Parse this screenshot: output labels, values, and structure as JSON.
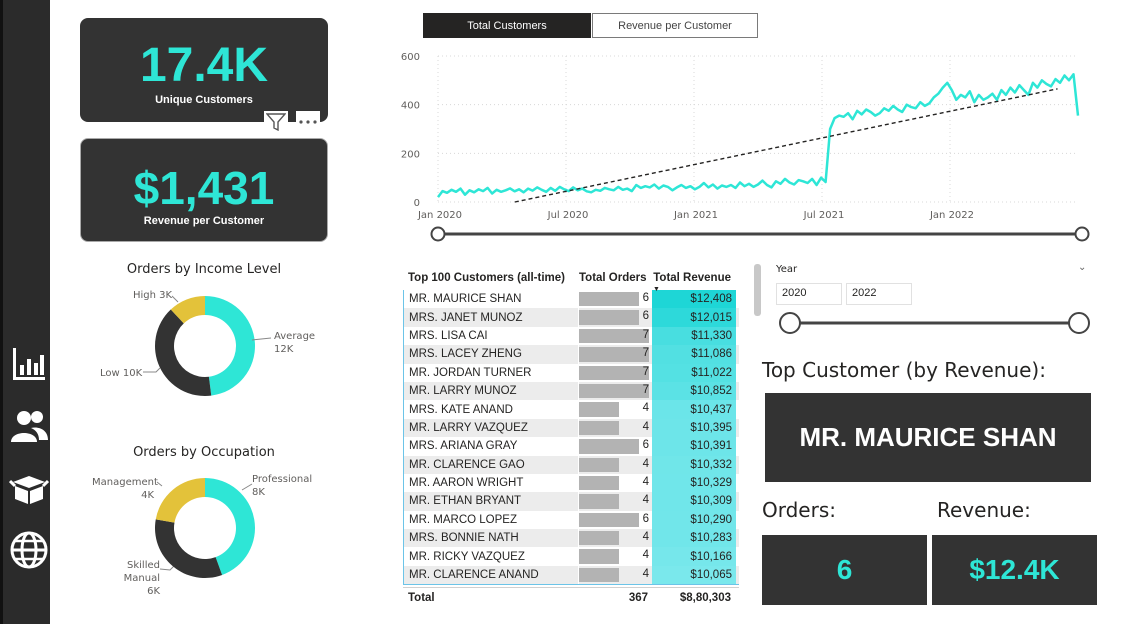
{
  "kpis": {
    "customers": {
      "value": "17.4K",
      "label": "Unique Customers"
    },
    "revenue_per_customer": {
      "value": "$1,431",
      "label": "Revenue per Customer"
    }
  },
  "colors": {
    "accent": "#2ee6d6",
    "dark": "#333333",
    "gold": "#e3c23a",
    "bar": "#b3b3b3"
  },
  "nav": [
    "bar-chart-icon",
    "users-icon",
    "box-icon",
    "globe-icon"
  ],
  "donut_income": {
    "title": "Orders by Income Level",
    "slices": [
      {
        "name": "Average",
        "label": "Average",
        "value_label": "12K",
        "value": 12,
        "color": "#2ee6d6"
      },
      {
        "name": "Low",
        "label": "Low 10K",
        "value": 10,
        "color": "#333333"
      },
      {
        "name": "High",
        "label": "High 3K",
        "value": 3,
        "color": "#e3c23a"
      }
    ]
  },
  "donut_occupation": {
    "title": "Orders by Occupation",
    "slices": [
      {
        "name": "Professional",
        "label": "Professional",
        "value_label": "8K",
        "value": 8,
        "color": "#2ee6d6"
      },
      {
        "name": "Skilled Manual",
        "label": "Skilled Manual",
        "value_label": "6K",
        "value": 6,
        "color": "#333333"
      },
      {
        "name": "Management",
        "label": "Management",
        "value_label": "4K",
        "value": 4,
        "color": "#e3c23a"
      }
    ]
  },
  "tabs": {
    "active": "Total Customers",
    "inactive": "Revenue per Customer"
  },
  "chart_data": {
    "type": "line",
    "ylim": [
      0,
      600
    ],
    "yticks": [
      0,
      200,
      400,
      600
    ],
    "xticks": [
      "Jan 2020",
      "Jul 2020",
      "Jan 2021",
      "Jul 2021",
      "Jan 2022"
    ],
    "xrange": [
      "2020-01",
      "2022-06"
    ],
    "grid": true,
    "series": [
      {
        "values": [
          20,
          45,
          38,
          50,
          42,
          55,
          30,
          48,
          40,
          52,
          45,
          58,
          35,
          50,
          42,
          48,
          56,
          44,
          52,
          40,
          55,
          47,
          60,
          50,
          42,
          58,
          46,
          62,
          52,
          45,
          60,
          48,
          55,
          44,
          40,
          50,
          46,
          58,
          52,
          48,
          62,
          50,
          55,
          45,
          70,
          58,
          65,
          60,
          72,
          55,
          68,
          62,
          48,
          60,
          70,
          58,
          65,
          52,
          62,
          78,
          60,
          72,
          55,
          68,
          62,
          70,
          58,
          80,
          65,
          75,
          62,
          72,
          88,
          70,
          60,
          85,
          75,
          95,
          80,
          72,
          90,
          85,
          78,
          95,
          70,
          100,
          82,
          300,
          345,
          355,
          350,
          365,
          340,
          375,
          360,
          380,
          370,
          355,
          365,
          385,
          375,
          395,
          380,
          370,
          400,
          390,
          385,
          410,
          395,
          405,
          430,
          445,
          470,
          490,
          460,
          420,
          440,
          430,
          455,
          410,
          440,
          420,
          430,
          445,
          420,
          460,
          440,
          470,
          450,
          480,
          460,
          440,
          490,
          470,
          500,
          485,
          475,
          505,
          490,
          520,
          500,
          525,
          355
        ]
      }
    ],
    "trendline": {
      "from": [
        2020.3,
        0
      ],
      "to": [
        2022.42,
        465
      ]
    }
  },
  "table": {
    "title": "Top 100 Customers (all-time)",
    "col_orders": "Total Orders",
    "col_revenue": "Total Revenue",
    "rows": [
      {
        "name": "MR. MAURICE SHAN",
        "orders": 6,
        "revenue": "$12,408",
        "rev": 12408
      },
      {
        "name": "MRS. JANET MUNOZ",
        "orders": 6,
        "revenue": "$12,015",
        "rev": 12015
      },
      {
        "name": "MRS. LISA CAI",
        "orders": 7,
        "revenue": "$11,330",
        "rev": 11330
      },
      {
        "name": "MRS. LACEY ZHENG",
        "orders": 7,
        "revenue": "$11,086",
        "rev": 11086
      },
      {
        "name": "MR. JORDAN TURNER",
        "orders": 7,
        "revenue": "$11,022",
        "rev": 11022
      },
      {
        "name": "MR. LARRY MUNOZ",
        "orders": 7,
        "revenue": "$10,852",
        "rev": 10852
      },
      {
        "name": "MRS. KATE ANAND",
        "orders": 4,
        "revenue": "$10,437",
        "rev": 10437
      },
      {
        "name": "MR. LARRY VAZQUEZ",
        "orders": 4,
        "revenue": "$10,395",
        "rev": 10395
      },
      {
        "name": "MRS. ARIANA GRAY",
        "orders": 6,
        "revenue": "$10,391",
        "rev": 10391
      },
      {
        "name": "MR. CLARENCE GAO",
        "orders": 4,
        "revenue": "$10,332",
        "rev": 10332
      },
      {
        "name": "MR. AARON WRIGHT",
        "orders": 4,
        "revenue": "$10,329",
        "rev": 10329
      },
      {
        "name": "MR. ETHAN BRYANT",
        "orders": 4,
        "revenue": "$10,309",
        "rev": 10309
      },
      {
        "name": "MR. MARCO LOPEZ",
        "orders": 6,
        "revenue": "$10,290",
        "rev": 10290
      },
      {
        "name": "MRS. BONNIE NATH",
        "orders": 4,
        "revenue": "$10,283",
        "rev": 10283
      },
      {
        "name": "MR. RICKY VAZQUEZ",
        "orders": 4,
        "revenue": "$10,166",
        "rev": 10166
      },
      {
        "name": "MR. CLARENCE ANAND",
        "orders": 4,
        "revenue": "$10,065",
        "rev": 10065
      }
    ],
    "total_label": "Total",
    "total_orders": "367",
    "total_revenue": "$8,80,303"
  },
  "slicer": {
    "label": "Year",
    "from": "2020",
    "to": "2022"
  },
  "top_customer": {
    "label": "Top Customer (by Revenue):",
    "name": "MR. MAURICE SHAN"
  },
  "orders": {
    "label": "Orders:",
    "value": "6"
  },
  "revenue": {
    "label": "Revenue:",
    "value": "$12.4K"
  }
}
